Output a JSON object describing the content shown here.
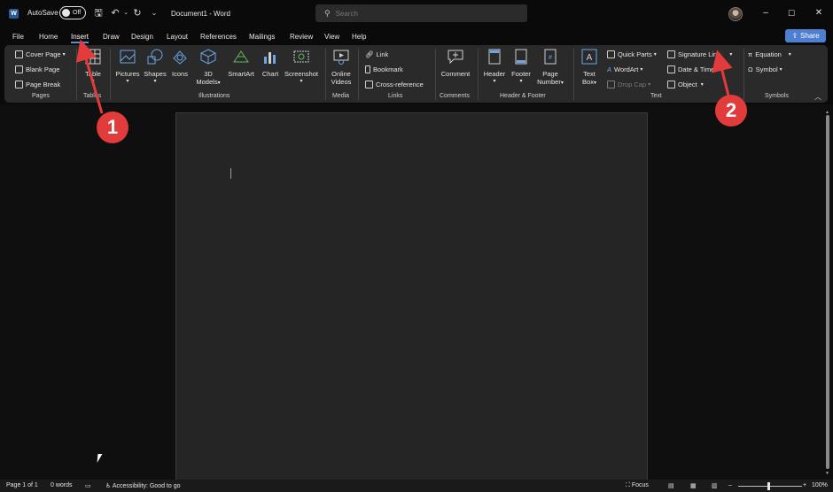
{
  "titlebar": {
    "logo": "W",
    "autosave_label": "AutoSave",
    "autosave_state": "Off",
    "doc_title": "Document1 - Word",
    "search_placeholder": "Search",
    "icons": [
      "save-icon",
      "undo-icon",
      "redo-icon",
      "customize-quick-access-icon"
    ],
    "window_buttons": [
      "minimize-icon",
      "restore-icon",
      "close-icon"
    ]
  },
  "tabs": [
    "File",
    "Home",
    "Insert",
    "Draw",
    "Design",
    "Layout",
    "References",
    "Mailings",
    "Review",
    "View",
    "Help"
  ],
  "active_tab": "Insert",
  "share_label": "Share",
  "ribbon": {
    "pages": {
      "label": "Pages",
      "items": [
        "Cover Page",
        "Blank Page",
        "Page Break"
      ]
    },
    "tables": {
      "label": "Tables",
      "items": [
        "Table"
      ]
    },
    "illustrations": {
      "label": "Illustrations",
      "items": [
        "Pictures",
        "Shapes",
        "Icons",
        "3D",
        "Models",
        "SmartArt",
        "Chart",
        "Screenshot"
      ]
    },
    "media": {
      "label": "Media",
      "items": [
        "Online",
        "Videos"
      ]
    },
    "links": {
      "label": "Links",
      "items": [
        "Link",
        "Bookmark",
        "Cross-reference"
      ]
    },
    "comments": {
      "label": "Comments",
      "items": [
        "Comment"
      ]
    },
    "header_footer": {
      "label": "Header & Footer",
      "items": [
        "Header",
        "Footer",
        "Page",
        "Number"
      ]
    },
    "text": {
      "label": "Text",
      "items": [
        "Text",
        "Box",
        "Quick Parts",
        "WordArt",
        "Drop Cap",
        "Signature Line",
        "Date & Time",
        "Object"
      ]
    },
    "symbols": {
      "label": "Symbols",
      "items": [
        "Equation",
        "Symbol"
      ]
    }
  },
  "statusbar": {
    "page": "Page 1 of 1",
    "words": "0 words",
    "accessibility": "Accessibility: Good to go",
    "focus": "Focus",
    "zoom": "100%"
  },
  "annotations": {
    "badge1": "1",
    "badge2": "2"
  },
  "colors": {
    "accent": "#4f7fd1",
    "annotation": "#e23b3b",
    "ribbon_bg": "#2a2a2a",
    "page_bg": "#252525"
  }
}
